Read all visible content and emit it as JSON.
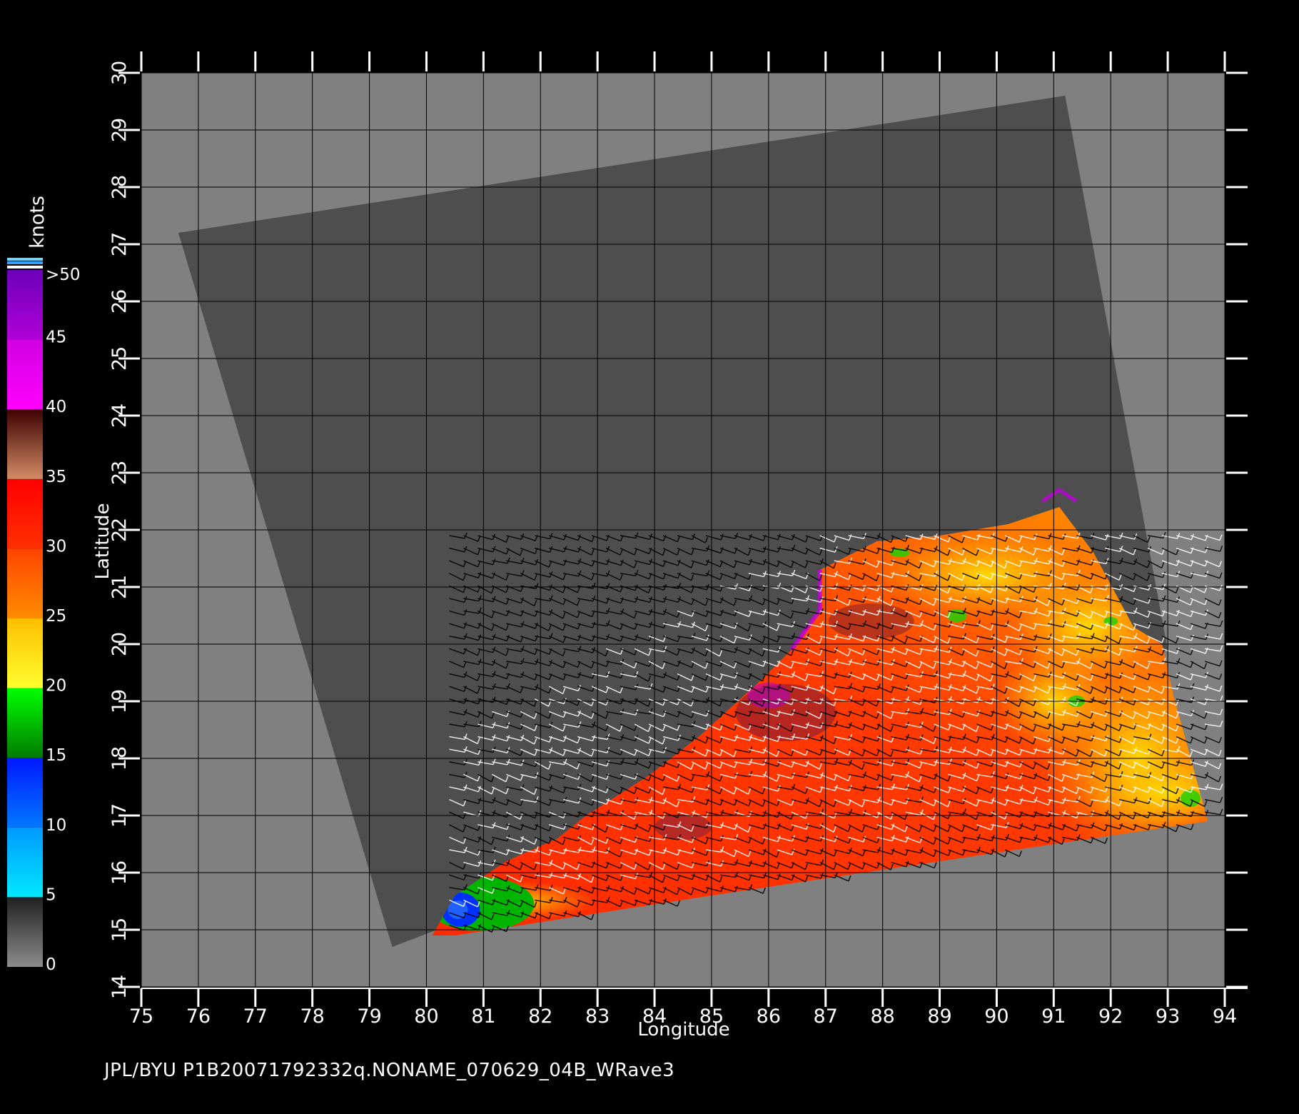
{
  "map": {
    "x_axis_label": "Longitude",
    "y_axis_label": "Latitude",
    "lon_ticks": [
      "75",
      "76",
      "77",
      "78",
      "79",
      "80",
      "81",
      "82",
      "83",
      "84",
      "85",
      "86",
      "87",
      "88",
      "89",
      "90",
      "91",
      "92",
      "93",
      "94"
    ],
    "lat_ticks": [
      "14",
      "15",
      "16",
      "17",
      "18",
      "19",
      "20",
      "21",
      "22",
      "23",
      "24",
      "25",
      "26",
      "27",
      "28",
      "29",
      "30"
    ],
    "lon_range": [
      75,
      94
    ],
    "lat_range": [
      14,
      30
    ],
    "swath_polygon_lonlat": [
      [
        75.65,
        27.2
      ],
      [
        91.2,
        29.6
      ],
      [
        93.0,
        19.9
      ],
      [
        79.4,
        14.7
      ]
    ],
    "wind_region_polygon_lonlat": [
      [
        80.1,
        14.9
      ],
      [
        80.5,
        15.6
      ],
      [
        81.4,
        16.2
      ],
      [
        82.3,
        16.6
      ],
      [
        82.8,
        17.0
      ],
      [
        83.9,
        17.7
      ],
      [
        84.8,
        18.4
      ],
      [
        85.9,
        19.4
      ],
      [
        86.4,
        19.9
      ],
      [
        86.9,
        20.6
      ],
      [
        86.9,
        21.3
      ],
      [
        87.9,
        21.8
      ],
      [
        89.0,
        21.9
      ],
      [
        90.2,
        22.1
      ],
      [
        91.1,
        22.4
      ],
      [
        91.7,
        21.6
      ],
      [
        92.4,
        20.3
      ],
      [
        92.9,
        20.0
      ],
      [
        93.1,
        19.1
      ],
      [
        93.35,
        18.2
      ],
      [
        93.7,
        16.9
      ],
      [
        89.0,
        16.2
      ],
      [
        85.0,
        15.6
      ],
      [
        80.5,
        14.9
      ]
    ]
  },
  "colorbar": {
    "unit": "knots",
    "labels": [
      ">50",
      "45",
      "40",
      "35",
      "30",
      "25",
      "20",
      "15",
      "10",
      "5",
      "0"
    ],
    "bands": [
      {
        "from": 0,
        "to": 5,
        "colors": [
          "#8c8c8c",
          "#202020"
        ]
      },
      {
        "from": 5,
        "to": 10,
        "colors": [
          "#00e8ff",
          "#0098ff"
        ]
      },
      {
        "from": 10,
        "to": 15,
        "colors": [
          "#0078ff",
          "#0018ff"
        ]
      },
      {
        "from": 15,
        "to": 20,
        "colors": [
          "#007a00",
          "#00ff00"
        ]
      },
      {
        "from": 20,
        "to": 25,
        "colors": [
          "#ffff30",
          "#ffbe00"
        ]
      },
      {
        "from": 25,
        "to": 30,
        "colors": [
          "#ff8c00",
          "#ff4400"
        ]
      },
      {
        "from": 30,
        "to": 35,
        "colors": [
          "#ff3000",
          "#ff0000"
        ]
      },
      {
        "from": 35,
        "to": 40,
        "colors": [
          "#d28c64",
          "#3c0000"
        ]
      },
      {
        "from": 40,
        "to": 45,
        "colors": [
          "#ff00ff",
          "#d000e0"
        ]
      },
      {
        "from": 45,
        "to": 50,
        "colors": [
          "#b000d8",
          "#6a00b8"
        ]
      }
    ]
  },
  "colors": {
    "background": "#000000",
    "map_bg": "#808080",
    "swath": "#4e4e4e",
    "grid": "#000000",
    "barb_dark": "#000000",
    "barb_light": "#ffffff"
  },
  "footer": "JPL/BYU  P1B20071792332q.NONAME_070629_04B_WRave3"
}
